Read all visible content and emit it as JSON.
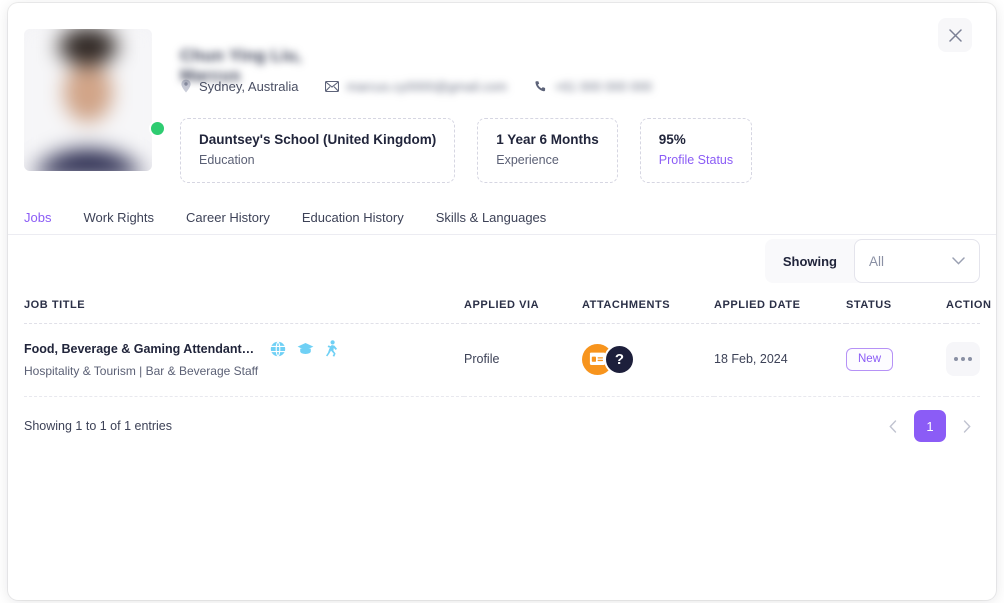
{
  "modal": {
    "close_label": "×"
  },
  "profile": {
    "name": "Chun Ying Liu, Marcus",
    "location": "Sydney, Australia",
    "email": "marcus.cy0000@gmail.com",
    "phone": "+61 000 000 000",
    "online_status": "online",
    "stats": [
      {
        "title": "Dauntsey's School (United Kingdom)",
        "sub": "Education",
        "is_link": false
      },
      {
        "title": "1 Year 6 Months",
        "sub": "Experience",
        "is_link": false
      },
      {
        "title": "95%",
        "sub": "Profile Status",
        "is_link": true
      }
    ]
  },
  "tabs": [
    {
      "label": "Jobs",
      "active": true
    },
    {
      "label": "Work Rights",
      "active": false
    },
    {
      "label": "Career History",
      "active": false
    },
    {
      "label": "Education History",
      "active": false
    },
    {
      "label": "Skills & Languages",
      "active": false
    }
  ],
  "filter": {
    "label": "Showing",
    "selected": "All",
    "options": [
      "All"
    ]
  },
  "table": {
    "columns": [
      "JOB TITLE",
      "APPLIED VIA",
      "ATTACHMENTS",
      "APPLIED DATE",
      "STATUS",
      "ACTION"
    ],
    "rows": [
      {
        "job_title": "Food, Beverage & Gaming Attendant – Hi...",
        "job_category": "Hospitality & Tourism | Bar & Beverage Staff",
        "job_icons": [
          "globe-icon",
          "graduation-cap-icon",
          "person-walking-icon"
        ],
        "applied_via": "Profile",
        "attachments": [
          "id-card-badge",
          "question-mark-badge"
        ],
        "applied_date": "18 Feb, 2024",
        "status": "New",
        "action": "more-options"
      }
    ]
  },
  "footer": {
    "entries_text": "Showing 1 to 1 of 1 entries",
    "prev_label": "‹",
    "current_page": "1",
    "next_label": "›"
  },
  "colors": {
    "accent_purple": "#8b5cf6",
    "online_green": "#2ecc71",
    "badge_orange": "#f7941d",
    "badge_dark": "#1d1f3b",
    "job_icon_blue": "#6fd0f5"
  }
}
